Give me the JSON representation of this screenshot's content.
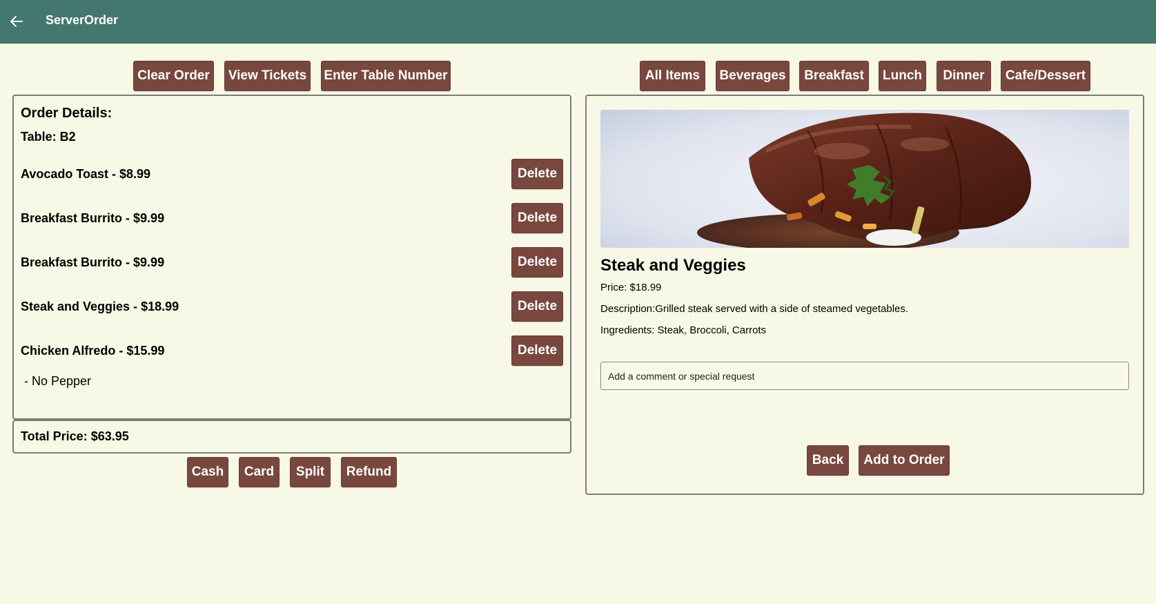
{
  "header": {
    "title": "ServerOrder",
    "back_icon": "arrow-left-icon"
  },
  "order_toolbar": {
    "clear_order": "Clear Order",
    "view_tickets": "View Tickets",
    "enter_table_number": "Enter Table Number"
  },
  "categories": [
    "All Items",
    "Beverages",
    "Breakfast",
    "Lunch",
    "Dinner",
    "Cafe/Dessert"
  ],
  "order": {
    "heading": "Order Details:",
    "table": "Table: B2",
    "items": [
      {
        "label": "Avocado Toast - $8.99",
        "delete": "Delete"
      },
      {
        "label": "Breakfast Burrito - $9.99",
        "delete": "Delete"
      },
      {
        "label": "Breakfast Burrito - $9.99",
        "delete": "Delete"
      },
      {
        "label": "Steak and Veggies - $18.99",
        "delete": "Delete"
      },
      {
        "label": "Chicken Alfredo - $15.99",
        "delete": "Delete",
        "note": " - No Pepper"
      }
    ],
    "total": "Total Price: $63.95"
  },
  "payment": {
    "cash": "Cash",
    "card": "Card",
    "split": "Split",
    "refund": "Refund"
  },
  "item_detail": {
    "name": "Steak and Veggies",
    "price": "Price: $18.99",
    "description": "Description:Grilled steak served with a side of steamed vegetables.",
    "ingredients": "Ingredients: Steak, Broccoli, Carrots",
    "comment_placeholder": "Add a comment or special request",
    "back": "Back",
    "add_to_order": "Add to Order"
  },
  "colors": {
    "header_bg": "#44776e",
    "page_bg": "#f8f8e6",
    "button_bg": "#78473d",
    "button_text": "#ffffff"
  }
}
